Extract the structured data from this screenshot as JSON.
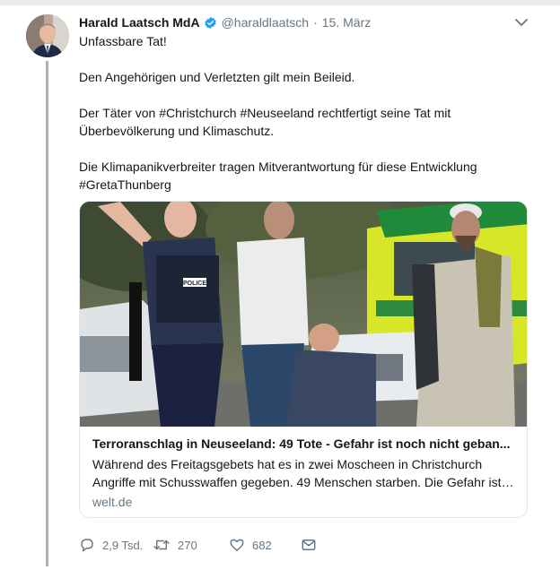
{
  "tweet": {
    "author_name": "Harald Laatsch MdA",
    "handle": "@haraldlaatsch",
    "separator": "·",
    "date": "15. März",
    "paragraphs": [
      "Unfassbare Tat!",
      "",
      "Den Angehörigen und Verletzten gilt mein Beileid.",
      "",
      "Der Täter von #Christchurch #Neuseeland rechtfertigt seine Tat mit",
      "Überbevölkerung und Klimaschutz.",
      "",
      "Die Klimapanikverbreiter tragen Mitverantwortung für diese Entwicklung",
      "#GretaThunberg"
    ]
  },
  "card": {
    "title": "Terroranschlag in Neuseeland: 49 Tote - Gefahr ist noch nicht geban...",
    "description": "Während des Freitagsgebets hat es in zwei Moscheen in Christchurch Angriffe mit Schusswaffen gegeben. 49 Menschen starben. Die Gefahr ist ...",
    "domain": "welt.de",
    "image_police_patch": "POLICE"
  },
  "actions": {
    "replies": "2,9 Tsd.",
    "retweets": "270",
    "likes": "682"
  },
  "icons": {
    "verified": "verified-badge-icon",
    "caret": "chevron-down-icon",
    "reply": "reply-icon",
    "retweet": "retweet-icon",
    "like": "heart-icon",
    "dm": "envelope-icon"
  },
  "colors": {
    "verified_blue": "#1da1f2",
    "secondary_text": "#657786",
    "thread_line": "#a9b3bb"
  }
}
